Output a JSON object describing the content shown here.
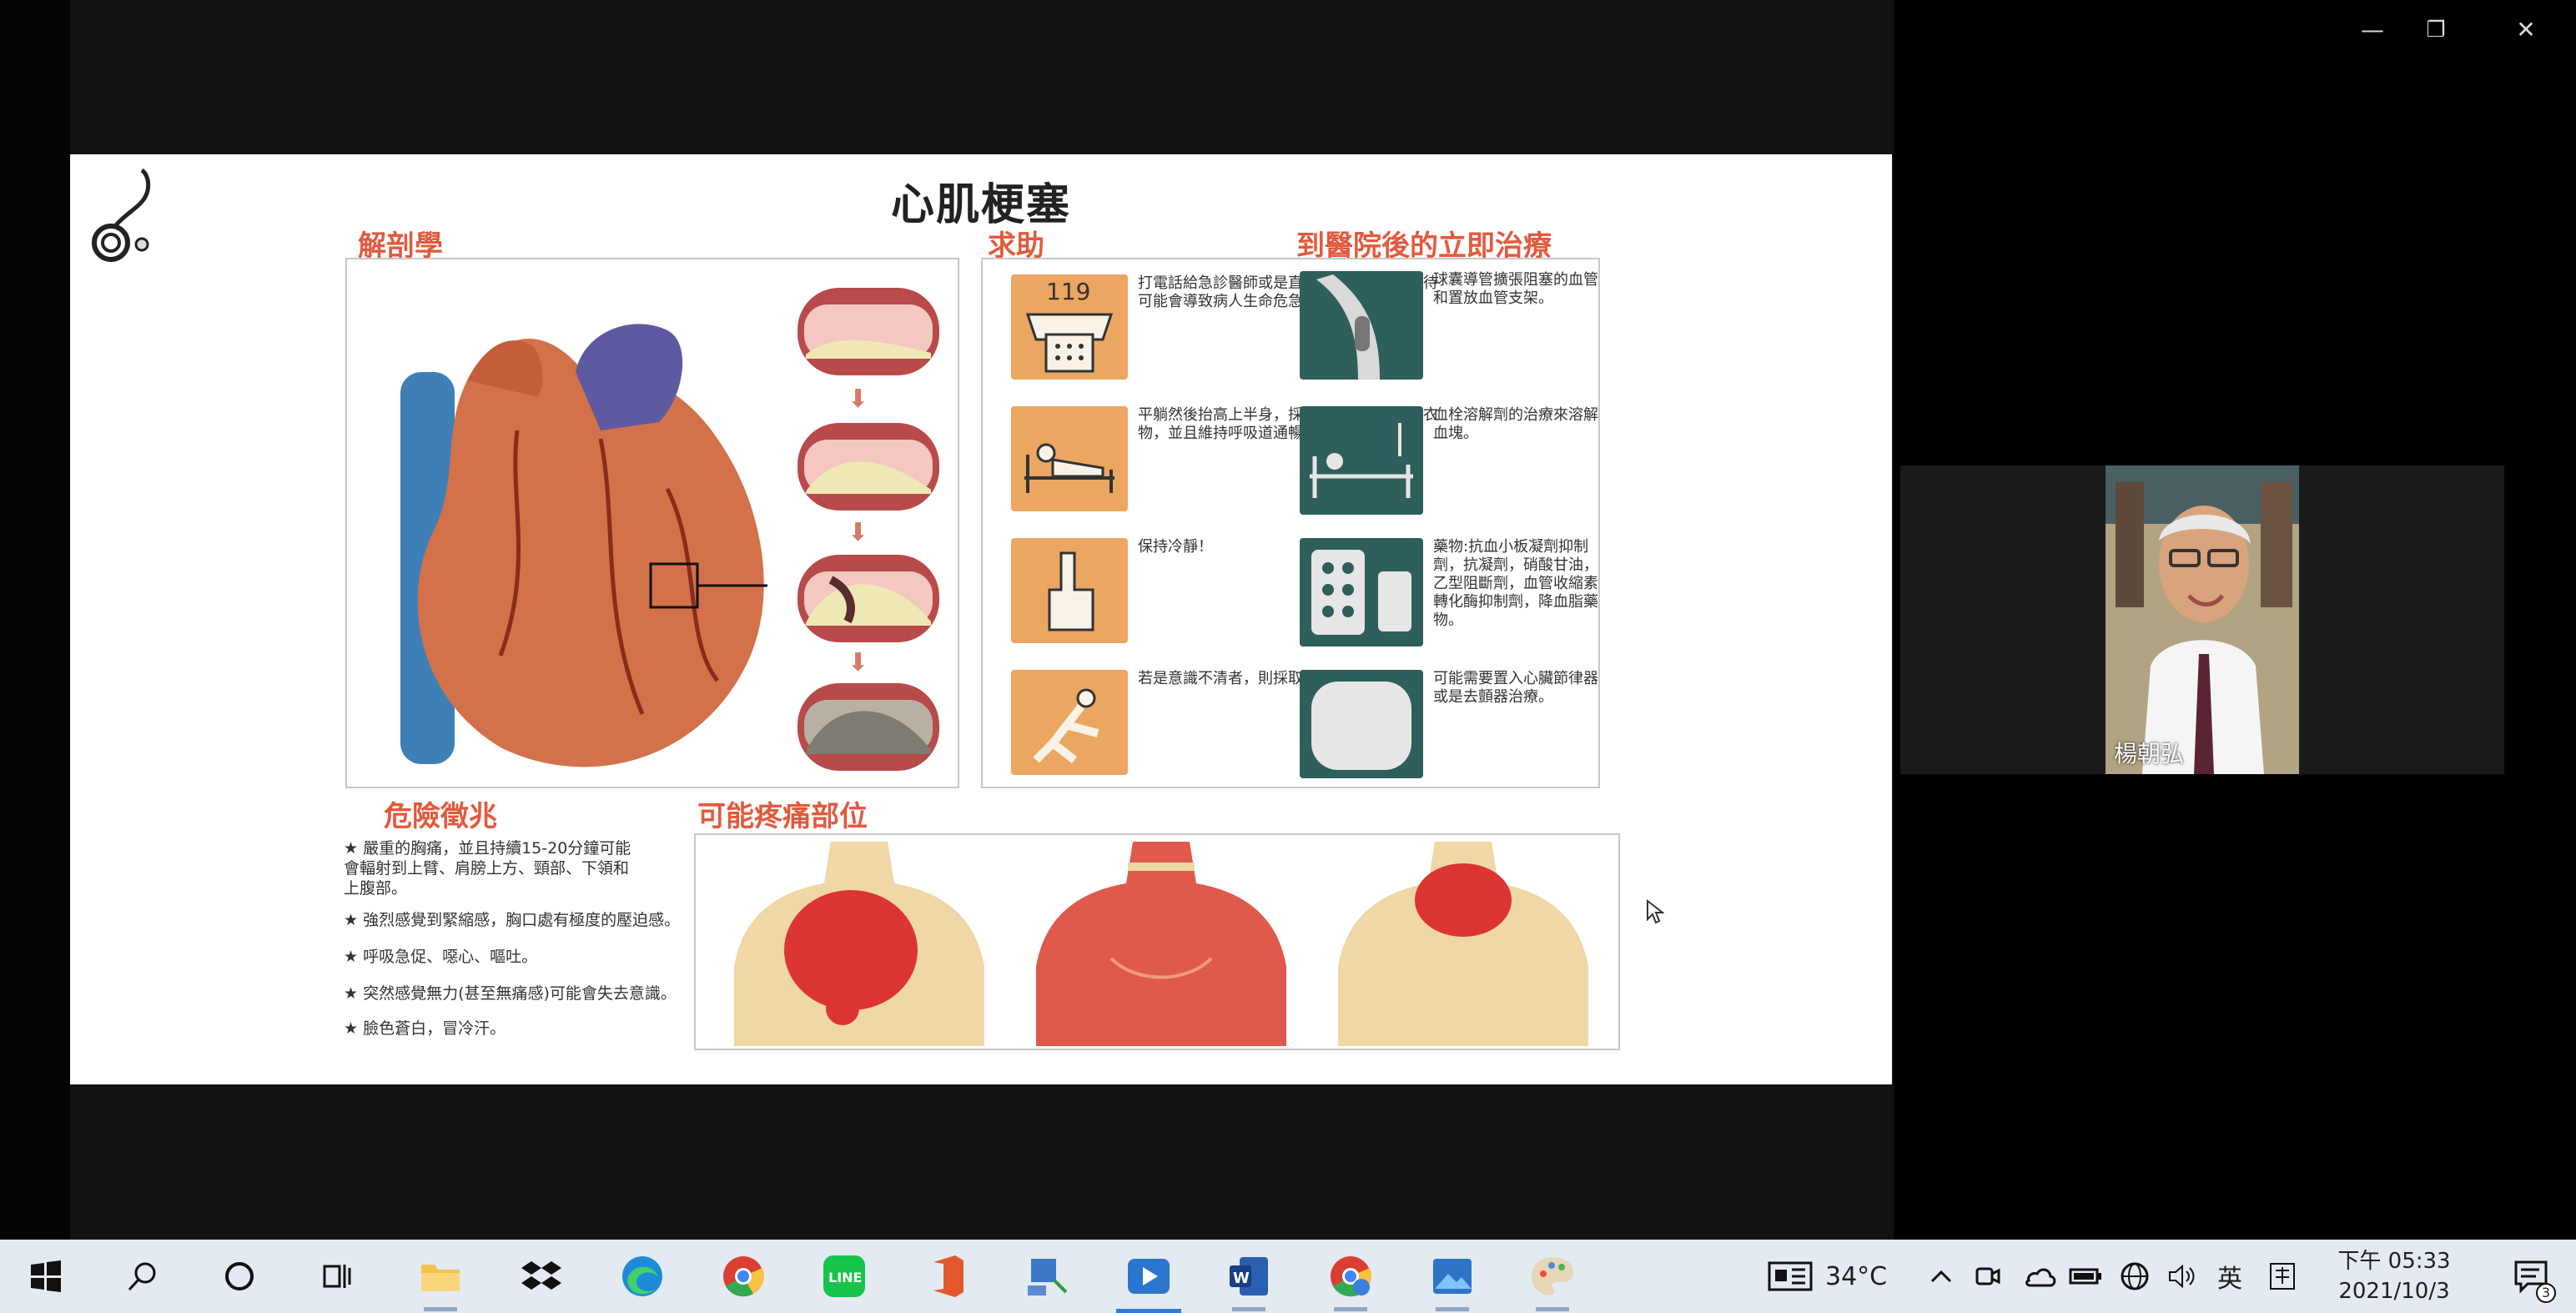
{
  "window": {
    "controls": [
      "minimize",
      "restore",
      "close"
    ]
  },
  "slide": {
    "title": "心肌梗塞",
    "sections": {
      "anatomy": "解剖學",
      "help": "求助",
      "treatment": "到醫院後的立即治療",
      "danger": "危險徵兆",
      "pain": "可能疼痛部位"
    },
    "help_steps": [
      {
        "icon_label": "119",
        "text": "打電話給急診醫師或是直接呼叫救護車，等待可能會導致病人生命危急。"
      },
      {
        "icon_label": "",
        "text": "平躺然後抬高上半身，採半坐臥，解開束縛衣物，並且維持呼吸道通暢。"
      },
      {
        "icon_label": "",
        "text": "保持冷靜！"
      },
      {
        "icon_label": "",
        "text": "若是意識不清者，則採取側臥的復甦姿勢。"
      }
    ],
    "treatments": [
      "球囊導管擴張阻塞的血管和置放血管支架。",
      "血栓溶解劑的治療來溶解血塊。",
      "藥物:抗血小板凝劑抑制劑，抗凝劑，硝酸甘油，乙型阻斷劑，血管收縮素轉化酶抑制劑，降血脂藥物。",
      "可能需要置入心臟節律器或是去顫器治療。"
    ],
    "danger_signs": [
      "嚴重的胸痛，並且持續15-20分鐘可能會輻射到上臂、肩膀上方、頸部、下領和上腹部。",
      "強烈感覺到緊縮感，胸口處有極度的壓迫感。",
      "呼吸急促、噁心、嘔吐。",
      "突然感覺無力(甚至無痛感)可能會失去意識。",
      "臉色蒼白，冒冷汗。"
    ]
  },
  "participant": {
    "name": "楊朝弘"
  },
  "taskbar": {
    "apps": [
      "start",
      "search",
      "cortana",
      "task-view",
      "file-explorer",
      "dropbox",
      "edge",
      "chrome",
      "line",
      "office",
      "remote-desktop",
      "media-player",
      "word",
      "chrome-profile",
      "photos",
      "paint"
    ],
    "weather": "34°C",
    "ime": "英",
    "time": "下午 05:33",
    "date": "2021/10/3",
    "notifications": "3"
  },
  "colors": {
    "section": "#e35a3d",
    "taskbar": "#e4eaf1",
    "accent": "#2f7dd6"
  }
}
